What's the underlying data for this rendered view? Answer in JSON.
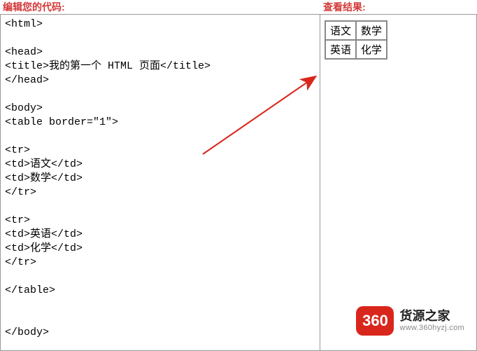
{
  "left": {
    "title": "编辑您的代码:",
    "code": "<html>\n\n<head>\n<title>我的第一个 HTML 页面</title>\n</head>\n\n<body>\n<table border=\"1\">\n\n<tr>\n<td>语文</td>\n<td>数学</td>\n</tr>\n\n<tr>\n<td>英语</td>\n<td>化学</td>\n</tr>\n\n</table>\n\n\n</body>\n"
  },
  "right": {
    "title": "查看结果:",
    "table": {
      "rows": [
        [
          "语文",
          "数学"
        ],
        [
          "英语",
          "化学"
        ]
      ]
    }
  },
  "logo": {
    "box": "360",
    "cn": "货源之家",
    "url": "www.360hyzj.com"
  }
}
